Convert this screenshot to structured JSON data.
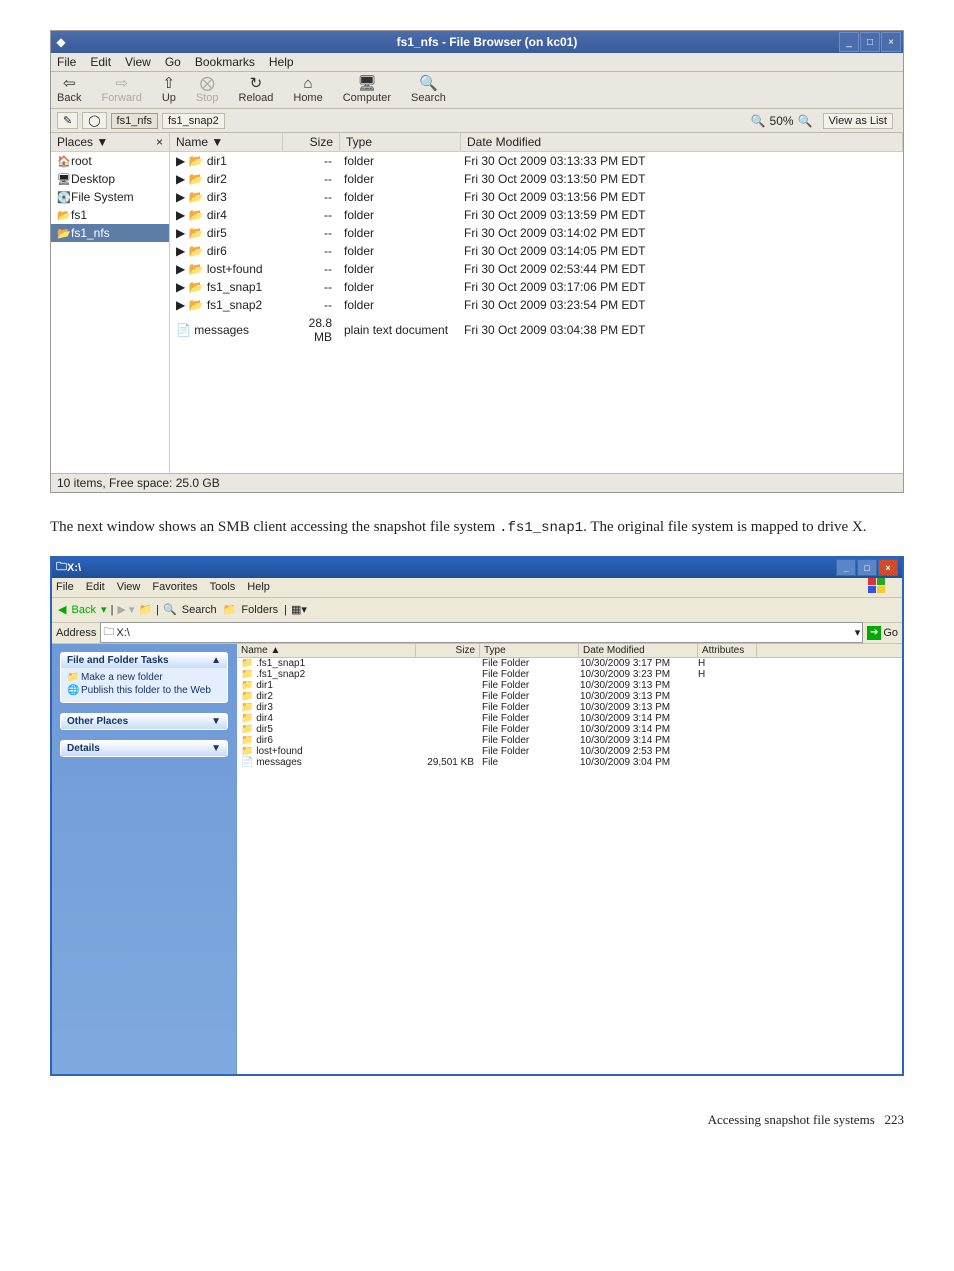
{
  "gnome": {
    "title": "fs1_nfs - File Browser (on kc01)",
    "menu": [
      "File",
      "Edit",
      "View",
      "Go",
      "Bookmarks",
      "Help"
    ],
    "toolbar": [
      {
        "l": "Back",
        "g": "⇦",
        "dis": false
      },
      {
        "l": "Forward",
        "g": "⇨",
        "dis": true
      },
      {
        "l": "Up",
        "g": "⇧",
        "dis": false
      },
      {
        "l": "Stop",
        "g": "⨂",
        "dis": true
      },
      {
        "l": "Reload",
        "g": "↻",
        "dis": false
      },
      {
        "l": "Home",
        "g": "⌂",
        "dis": false
      },
      {
        "l": "Computer",
        "g": "🖥",
        "dis": false
      },
      {
        "l": "Search",
        "g": "🔍",
        "dis": false
      }
    ],
    "path": {
      "crumbs": [
        "fs1_nfs",
        "fs1_snap2"
      ],
      "selected": 0
    },
    "zoom": "50%",
    "viewmode": "View as List",
    "places_hd": "Places ▼",
    "places": [
      {
        "l": "root",
        "g": "🏠",
        "sel": false
      },
      {
        "l": "Desktop",
        "g": "🖥",
        "sel": false
      },
      {
        "l": "File System",
        "g": "💽",
        "sel": false
      },
      {
        "l": "fs1",
        "g": "📂",
        "sel": false
      },
      {
        "l": "fs1_nfs",
        "g": "📂",
        "sel": true
      }
    ],
    "cols": [
      "Name",
      "Size",
      "Type",
      "Date Modified"
    ],
    "rows": [
      {
        "n": "dir1",
        "s": "--",
        "t": "folder",
        "d": "Fri 30 Oct 2009 03:13:33 PM EDT",
        "f": true
      },
      {
        "n": "dir2",
        "s": "--",
        "t": "folder",
        "d": "Fri 30 Oct 2009 03:13:50 PM EDT",
        "f": true
      },
      {
        "n": "dir3",
        "s": "--",
        "t": "folder",
        "d": "Fri 30 Oct 2009 03:13:56 PM EDT",
        "f": true
      },
      {
        "n": "dir4",
        "s": "--",
        "t": "folder",
        "d": "Fri 30 Oct 2009 03:13:59 PM EDT",
        "f": true
      },
      {
        "n": "dir5",
        "s": "--",
        "t": "folder",
        "d": "Fri 30 Oct 2009 03:14:02 PM EDT",
        "f": true
      },
      {
        "n": "dir6",
        "s": "--",
        "t": "folder",
        "d": "Fri 30 Oct 2009 03:14:05 PM EDT",
        "f": true
      },
      {
        "n": "lost+found",
        "s": "--",
        "t": "folder",
        "d": "Fri 30 Oct 2009 02:53:44 PM EDT",
        "f": true
      },
      {
        "n": "fs1_snap1",
        "s": "--",
        "t": "folder",
        "d": "Fri 30 Oct 2009 03:17:06 PM EDT",
        "f": true
      },
      {
        "n": "fs1_snap2",
        "s": "--",
        "t": "folder",
        "d": "Fri 30 Oct 2009 03:23:54 PM EDT",
        "f": true
      },
      {
        "n": "messages",
        "s": "28.8 MB",
        "t": "plain text document",
        "d": "Fri 30 Oct 2009 03:04:38 PM EDT",
        "f": false
      }
    ],
    "status": "10 items, Free space: 25.0 GB"
  },
  "paragraph": {
    "pre": "The next window shows an SMB client accessing the snapshot file system ",
    "code": ".fs1_snap1",
    "post": ". The original file system is mapped to drive X."
  },
  "win": {
    "title": "X:\\",
    "menu": [
      "File",
      "Edit",
      "View",
      "Favorites",
      "Tools",
      "Help"
    ],
    "tb_back": "Back",
    "tb_search": "Search",
    "tb_folders": "Folders",
    "addr_lbl": "Address",
    "addr_val": "X:\\",
    "go": "Go",
    "tasks": {
      "hd": "File and Folder Tasks",
      "items": [
        {
          "g": "📁",
          "l": "Make a new folder"
        },
        {
          "g": "🌐",
          "l": "Publish this folder to the Web"
        }
      ]
    },
    "other": {
      "hd": "Other Places"
    },
    "details": {
      "hd": "Details"
    },
    "cols": [
      "Name",
      "Size",
      "Type",
      "Date Modified",
      "Attributes"
    ],
    "rows": [
      {
        "n": ".fs1_snap1",
        "s": "",
        "t": "File Folder",
        "d": "10/30/2009 3:17 PM",
        "a": "H",
        "f": true,
        "h": true
      },
      {
        "n": ".fs1_snap2",
        "s": "",
        "t": "File Folder",
        "d": "10/30/2009 3:23 PM",
        "a": "H",
        "f": true,
        "h": true
      },
      {
        "n": "dir1",
        "s": "",
        "t": "File Folder",
        "d": "10/30/2009 3:13 PM",
        "a": "",
        "f": true
      },
      {
        "n": "dir2",
        "s": "",
        "t": "File Folder",
        "d": "10/30/2009 3:13 PM",
        "a": "",
        "f": true
      },
      {
        "n": "dir3",
        "s": "",
        "t": "File Folder",
        "d": "10/30/2009 3:13 PM",
        "a": "",
        "f": true
      },
      {
        "n": "dir4",
        "s": "",
        "t": "File Folder",
        "d": "10/30/2009 3:14 PM",
        "a": "",
        "f": true
      },
      {
        "n": "dir5",
        "s": "",
        "t": "File Folder",
        "d": "10/30/2009 3:14 PM",
        "a": "",
        "f": true
      },
      {
        "n": "dir6",
        "s": "",
        "t": "File Folder",
        "d": "10/30/2009 3:14 PM",
        "a": "",
        "f": true
      },
      {
        "n": "lost+found",
        "s": "",
        "t": "File Folder",
        "d": "10/30/2009 2:53 PM",
        "a": "",
        "f": true
      },
      {
        "n": "messages",
        "s": "29,501 KB",
        "t": "File",
        "d": "10/30/2009 3:04 PM",
        "a": "",
        "f": false
      }
    ]
  },
  "footer": {
    "section": "Accessing snapshot file systems",
    "page": "223"
  }
}
